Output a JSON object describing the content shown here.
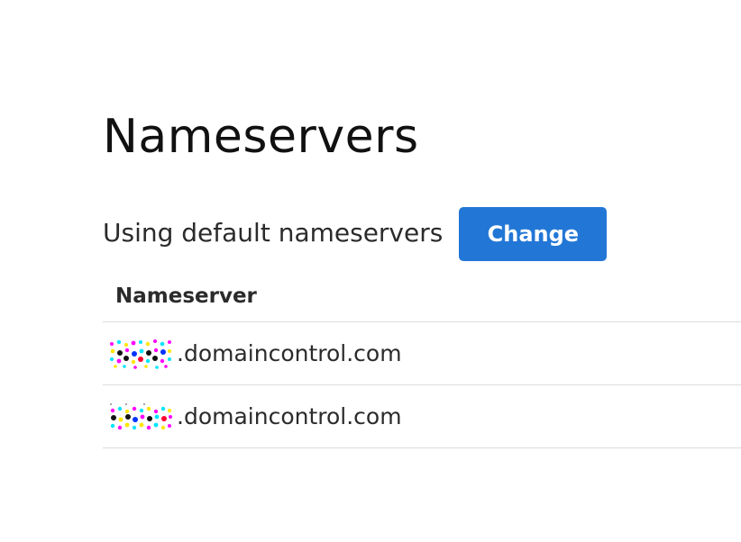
{
  "page": {
    "title": "Nameservers",
    "status_text": "Using default nameservers",
    "change_label": "Change"
  },
  "colors": {
    "button_bg": "#2277d6",
    "button_text": "#ffffff",
    "divider": "#dcdcdc",
    "text": "#2b2b2b"
  },
  "table": {
    "header": "Nameserver",
    "rows": [
      {
        "domain": ".domaincontrol.com"
      },
      {
        "domain": ".domaincontrol.com"
      }
    ]
  }
}
